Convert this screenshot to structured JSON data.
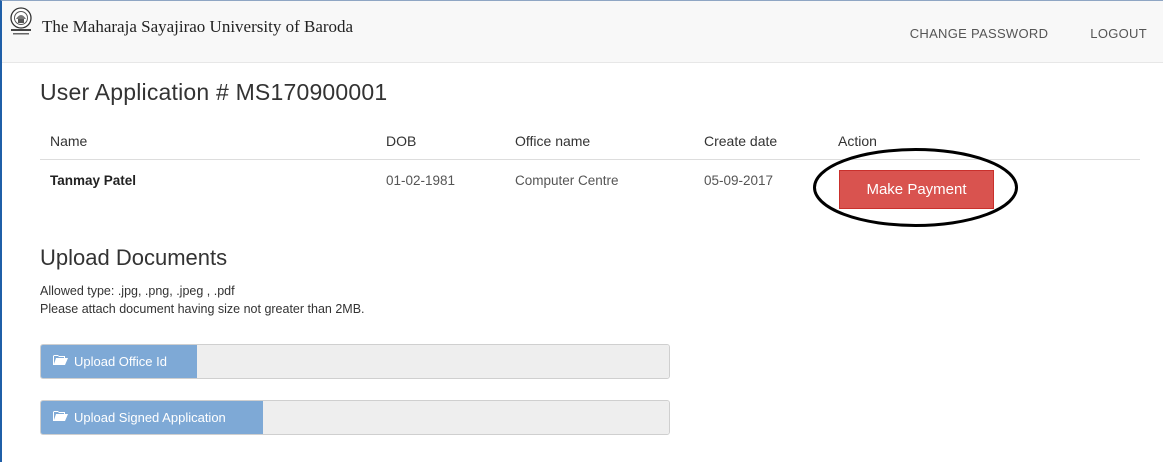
{
  "navbar": {
    "brand": "The Maharaja Sayajirao University of Baroda",
    "logo_icon": "university-crest-icon",
    "links": [
      "CHANGE PASSWORD",
      "LOGOUT"
    ]
  },
  "page": {
    "title": "User Application # MS170900001"
  },
  "table": {
    "headers": [
      "Name",
      "DOB",
      "Office name",
      "Create date",
      "Action"
    ],
    "row": {
      "name": "Tanmay Patel",
      "dob": "01-02-1981",
      "office": "Computer Centre",
      "create_date": "05-09-2017",
      "action_label": "Make Payment"
    }
  },
  "upload": {
    "title": "Upload Documents",
    "allowed_types": "Allowed type: .jpg, .png, .jpeg , .pdf",
    "size_note": "Please attach document having size not greater than 2MB.",
    "buttons": [
      {
        "label": "Upload Office Id",
        "icon": "folder-open-icon"
      },
      {
        "label": "Upload Signed Application",
        "icon": "folder-open-icon"
      }
    ]
  },
  "colors": {
    "danger": "#d9534f",
    "upload_button": "#7ea9d6",
    "navbar_bg": "#f8f8f8"
  }
}
